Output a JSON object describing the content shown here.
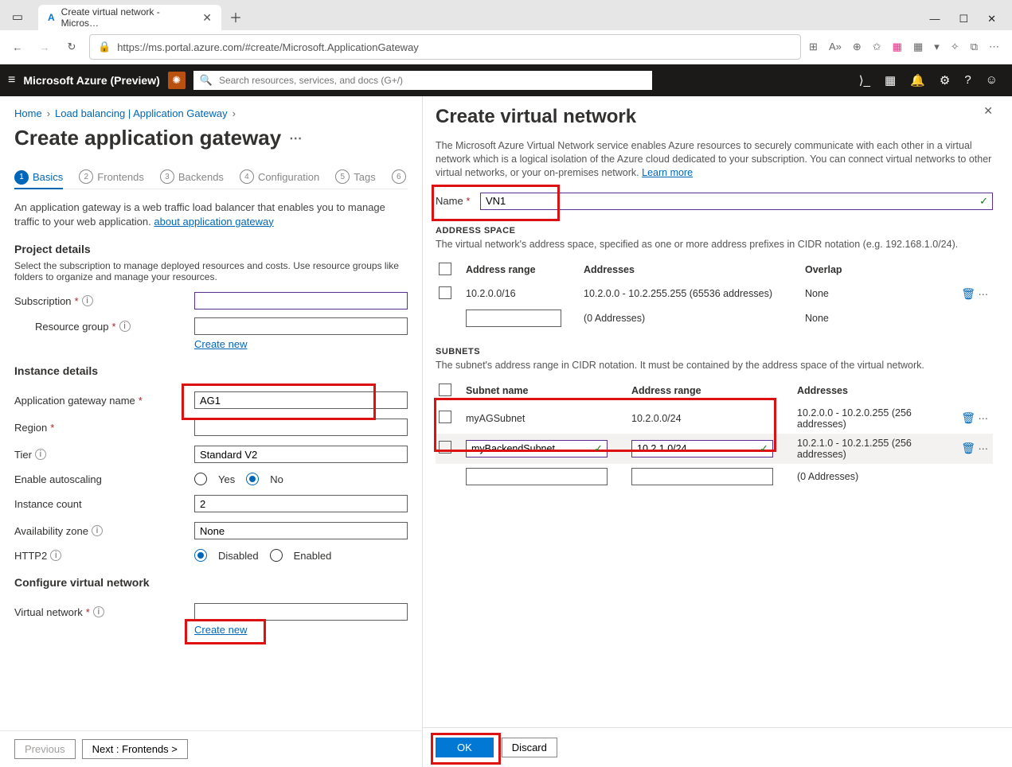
{
  "browser": {
    "tab_title": "Create virtual network - Micros…",
    "url": "https://ms.portal.azure.com/#create/Microsoft.ApplicationGateway"
  },
  "azure": {
    "brand": "Microsoft Azure (Preview)",
    "search_placeholder": "Search resources, services, and docs (G+/)"
  },
  "breadcrumb": {
    "home": "Home",
    "lb": "Load balancing | Application Gateway"
  },
  "page_title": "Create application gateway",
  "steps": {
    "s1": "Basics",
    "s2": "Frontends",
    "s3": "Backends",
    "s4": "Configuration",
    "s5": "Tags"
  },
  "desc1": "An application gateway is a web traffic load balancer that enables you to manage traffic to your web application. ",
  "desc_link": "about application gateway",
  "project_details_h": "Project details",
  "project_details_desc": "Select the subscription to manage deployed resources and costs. Use resource groups like folders to organize and manage your resources.",
  "labels": {
    "subscription": "Subscription",
    "resource_group": "Resource group",
    "create_new": "Create new",
    "instance_details_h": "Instance details",
    "app_gw_name": "Application gateway name",
    "region": "Region",
    "tier": "Tier",
    "tier_val": "Standard V2",
    "autoscale": "Enable autoscaling",
    "yes": "Yes",
    "no": "No",
    "instance_count": "Instance count",
    "instance_count_val": "2",
    "az": "Availability zone",
    "az_val": "None",
    "http2": "HTTP2",
    "disabled": "Disabled",
    "enabled": "Enabled",
    "configure_vn_h": "Configure virtual network",
    "vnet": "Virtual network",
    "app_gw_name_val": "AG1"
  },
  "footer": {
    "prev": "Previous",
    "next": "Next : Frontends >"
  },
  "panel": {
    "title": "Create virtual network",
    "desc": "The Microsoft Azure Virtual Network service enables Azure resources to securely communicate with each other in a virtual network which is a logical isolation of the Azure cloud dedicated to your subscription. You can connect virtual networks to other virtual networks, or your on-premises network.  ",
    "learn_more": "Learn more",
    "name_label": "Name",
    "name_val": "VN1",
    "address_space_h": "ADDRESS SPACE",
    "address_space_desc": "The virtual network's address space, specified as one or more address prefixes in CIDR notation (e.g. 192.168.1.0/24).",
    "cols": {
      "range": "Address range",
      "addresses": "Addresses",
      "overlap": "Overlap"
    },
    "row1": {
      "range": "10.2.0.0/16",
      "addresses": "10.2.0.0 - 10.2.255.255 (65536 addresses)",
      "overlap": "None"
    },
    "row2": {
      "addresses": "(0 Addresses)",
      "overlap": "None"
    },
    "subnets_h": "SUBNETS",
    "subnets_desc": "The subnet's address range in CIDR notation. It must be contained by the address space of the virtual network.",
    "sub_cols": {
      "name": "Subnet name",
      "range": "Address range",
      "addresses": "Addresses"
    },
    "sub1": {
      "name": "myAGSubnet",
      "range": "10.2.0.0/24",
      "addresses": "10.2.0.0 - 10.2.0.255 (256 addresses)"
    },
    "sub2": {
      "name": "myBackendSubnet",
      "range": "10.2.1.0/24",
      "addresses": "10.2.1.0 - 10.2.1.255 (256 addresses)"
    },
    "sub3": {
      "addresses": "(0 Addresses)"
    },
    "ok": "OK",
    "discard": "Discard"
  }
}
